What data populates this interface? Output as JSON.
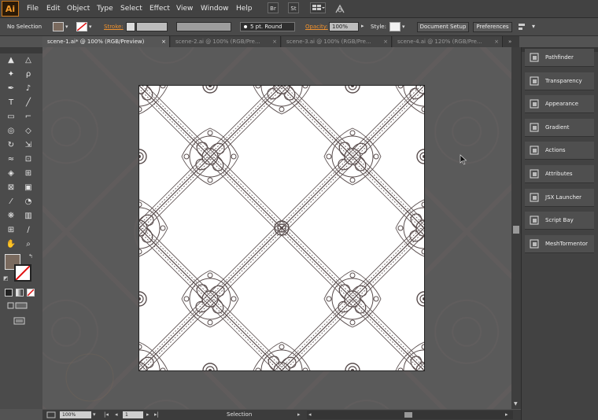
{
  "app": {
    "logo": "Ai"
  },
  "menu": [
    "File",
    "Edit",
    "Object",
    "Type",
    "Select",
    "Effect",
    "View",
    "Window",
    "Help"
  ],
  "toolbar_buttons": [
    "Br",
    "St"
  ],
  "control": {
    "selection_label": "No Selection",
    "stroke_label": "Stroke:",
    "brush_label": "5 pt. Round",
    "opacity_label": "Opacity:",
    "opacity_value": "100%",
    "style_label": "Style:",
    "document_setup": "Document Setup",
    "preferences": "Preferences"
  },
  "tabs": [
    {
      "label": "scene-1.ai* @ 100% (RGB/Preview)",
      "active": true
    },
    {
      "label": "scene-2.ai @ 100% (RGB/Pre...",
      "active": false
    },
    {
      "label": "scene-3.ai @ 100% (RGB/Pre...",
      "active": false
    },
    {
      "label": "scene-4.ai @ 120% (RGB/Pre...",
      "active": false
    }
  ],
  "tab_close": "×",
  "panels": [
    {
      "label": "Pathfinder",
      "icon": "pathfinder-icon"
    },
    {
      "label": "Transparency",
      "icon": "transparency-icon"
    },
    {
      "label": "Appearance",
      "icon": "appearance-icon"
    },
    {
      "label": "Gradient",
      "icon": "gradient-icon"
    },
    {
      "label": "Actions",
      "icon": "actions-icon"
    },
    {
      "label": "Attributes",
      "icon": "attributes-icon"
    },
    {
      "label": "JSX Launcher",
      "icon": "jsx-launcher-icon"
    },
    {
      "label": "Script Bay",
      "icon": "script-bay-icon"
    },
    {
      "label": "MeshTormentor",
      "icon": "mesh-tormentor-icon"
    }
  ],
  "status": {
    "zoom": "100%",
    "page": "1",
    "mode": "Selection"
  },
  "colors": {
    "accent": "#f0922e",
    "artboard": "#ffffff",
    "ornament": "#5a4e4e"
  }
}
